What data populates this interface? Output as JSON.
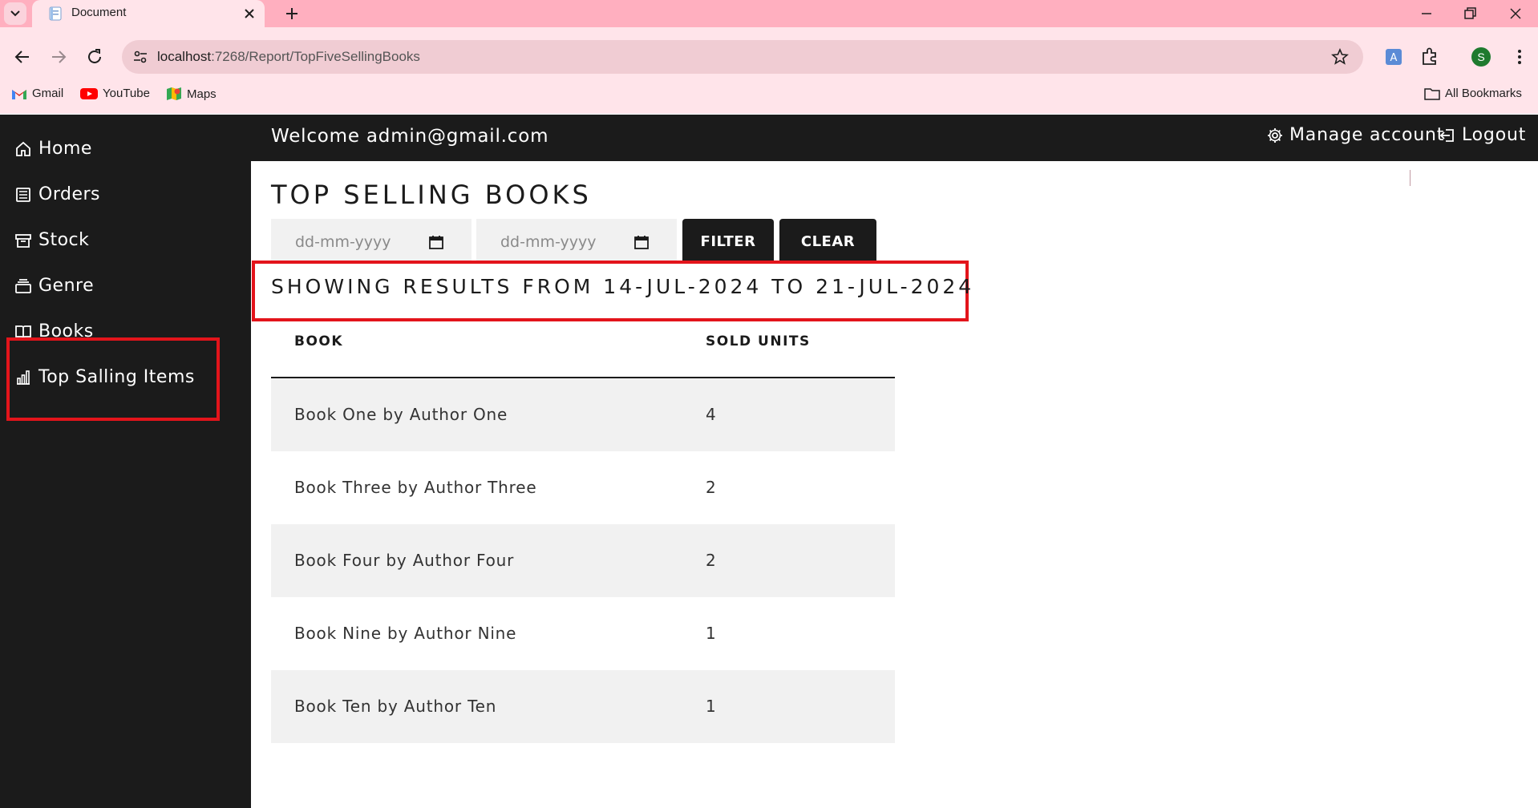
{
  "browser": {
    "tab_title": "Document",
    "url_host": "localhost",
    "url_path": ":7268/Report/TopFiveSellingBooks",
    "profile_initial": "S",
    "bookmarks": [
      {
        "label": "Gmail",
        "icon": "gmail-icon"
      },
      {
        "label": "YouTube",
        "icon": "youtube-icon"
      },
      {
        "label": "Maps",
        "icon": "maps-icon"
      }
    ],
    "all_bookmarks": "All Bookmarks"
  },
  "sidebar": {
    "items": [
      {
        "label": "Home",
        "icon": "home-icon"
      },
      {
        "label": "Orders",
        "icon": "orders-icon"
      },
      {
        "label": "Stock",
        "icon": "stock-icon"
      },
      {
        "label": "Genre",
        "icon": "genre-icon"
      },
      {
        "label": "Books",
        "icon": "books-icon"
      },
      {
        "label": "Top Salling Items",
        "icon": "bar-chart-icon"
      }
    ]
  },
  "header": {
    "welcome": "Welcome admin@gmail.com",
    "manage_account": "Manage account",
    "logout": "Logout"
  },
  "main": {
    "title": "TOP SELLING BOOKS",
    "from_placeholder": "dd-mm-yyyy",
    "to_placeholder": "dd-mm-yyyy",
    "filter_label": "FILTER",
    "clear_label": "CLEAR",
    "results_text": "SHOWING RESULTS FROM 14-JUL-2024 TO 21-JUL-2024",
    "columns": [
      "BOOK",
      "SOLD UNITS"
    ],
    "rows": [
      {
        "book": "Book One by Author One",
        "units": "4"
      },
      {
        "book": "Book Three by Author Three",
        "units": "2"
      },
      {
        "book": "Book Four by Author Four",
        "units": "2"
      },
      {
        "book": "Book Nine by Author Nine",
        "units": "1"
      },
      {
        "book": "Book Ten by Author Ten",
        "units": "1"
      }
    ]
  },
  "colors": {
    "tabbar": "#ffafbf",
    "toolbar": "#ffe4ea",
    "app_dark": "#1b1b1b",
    "highlight": "#e3141b",
    "row_alt": "#f1f1f1"
  }
}
